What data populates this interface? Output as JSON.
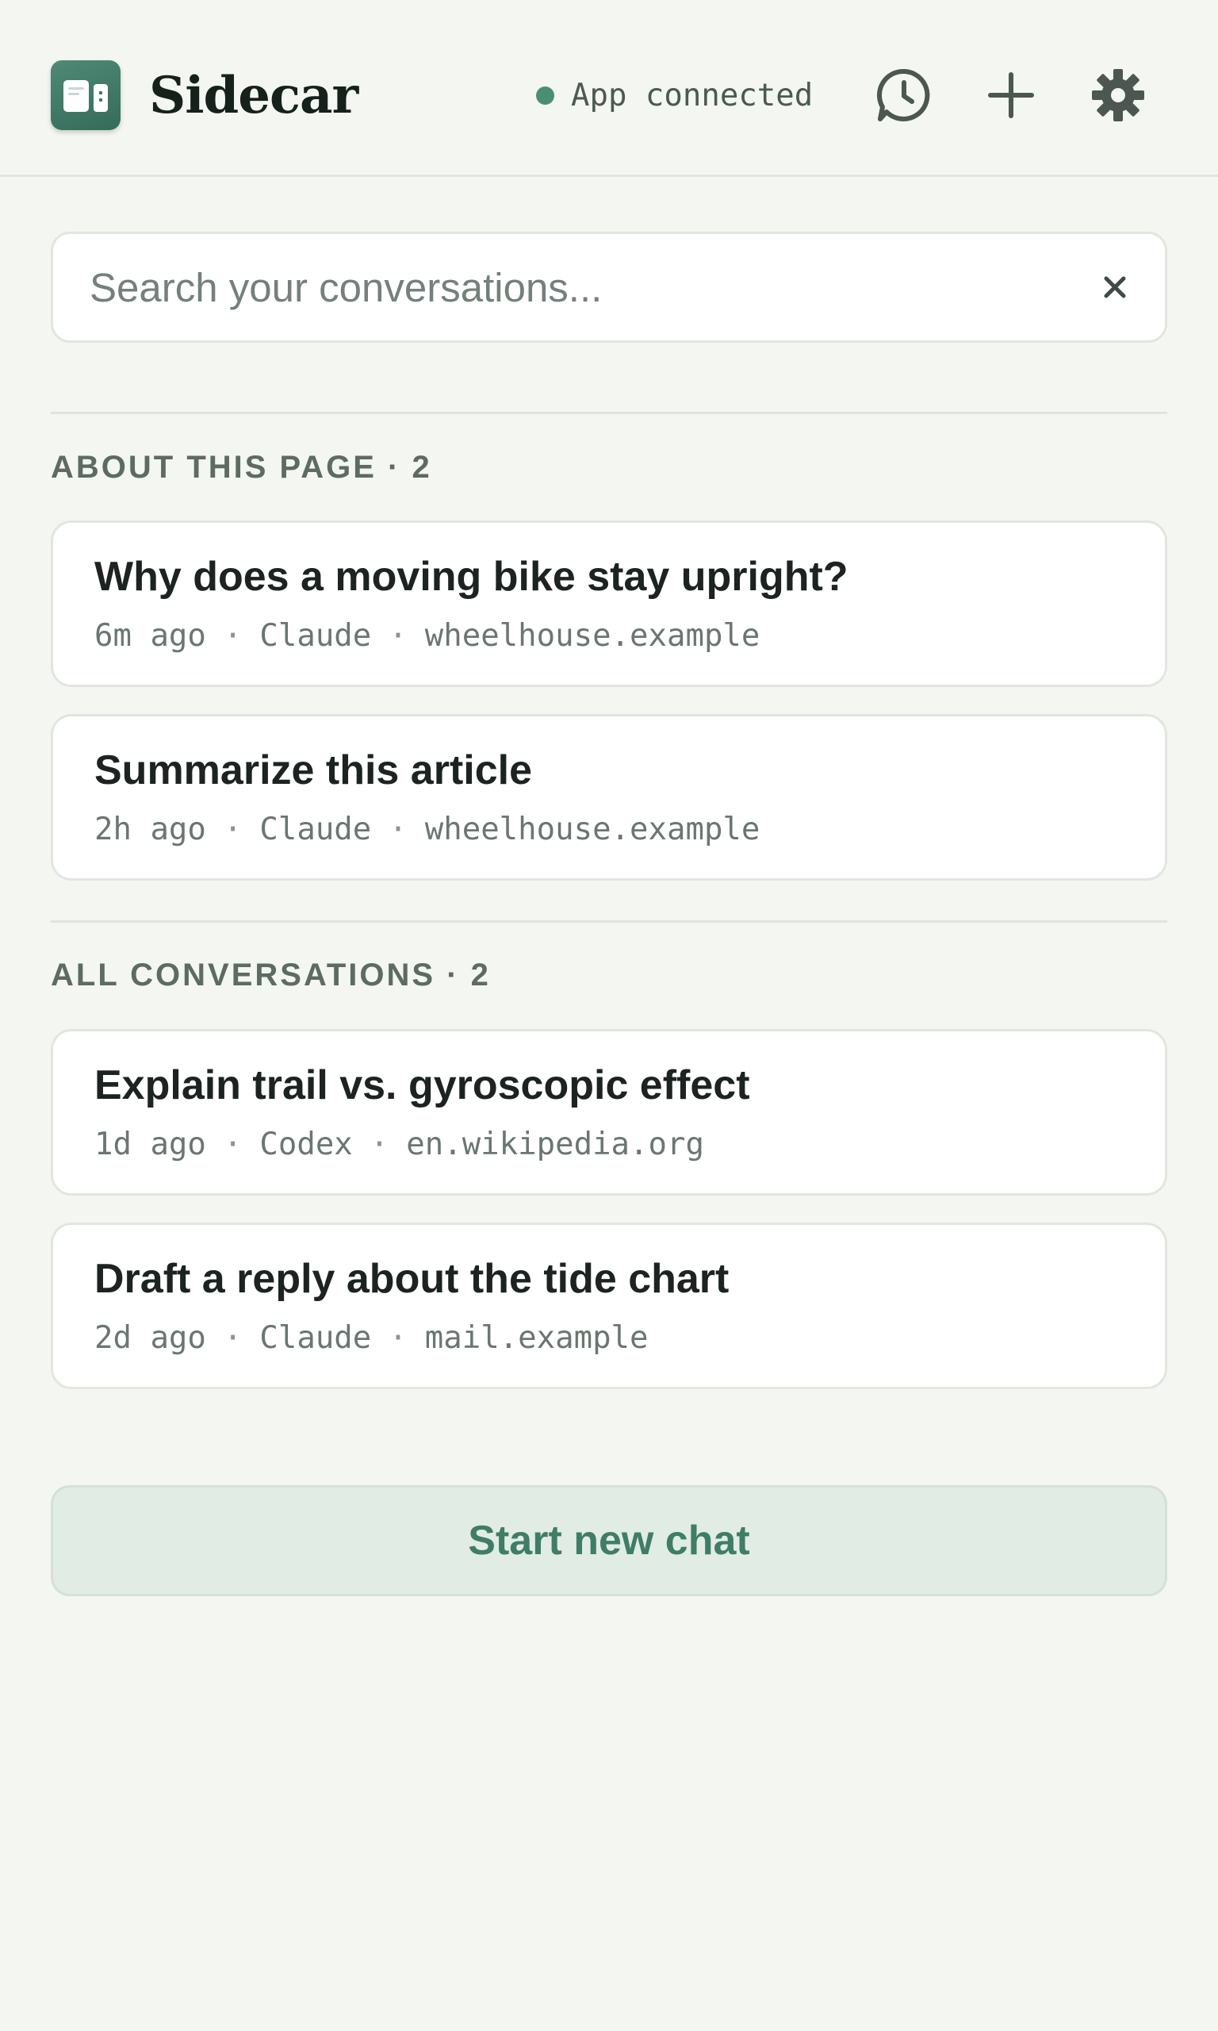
{
  "header": {
    "app_name": "Sidecar",
    "status_text": "App connected",
    "status_color": "#4b8f72",
    "actions": [
      {
        "icon": "history-icon"
      },
      {
        "icon": "plus-icon"
      },
      {
        "icon": "gear-icon"
      }
    ]
  },
  "search": {
    "placeholder": "Search your conversations...",
    "value": "",
    "clear_icon": "close-icon"
  },
  "sections": {
    "about_page": {
      "label": "ABOUT THIS PAGE · 2",
      "items": [
        {
          "title": "Why does a moving bike stay upright?",
          "time": "6m ago",
          "model": "Claude",
          "site": "wheelhouse.example"
        },
        {
          "title": "Summarize this article",
          "time": "2h ago",
          "model": "Claude",
          "site": "wheelhouse.example"
        }
      ]
    },
    "all": {
      "label": "ALL CONVERSATIONS · 2",
      "items": [
        {
          "title": "Explain trail vs. gyroscopic effect",
          "time": "1d ago",
          "model": "Codex",
          "site": "en.wikipedia.org"
        },
        {
          "title": "Draft a reply about the tide chart",
          "time": "2d ago",
          "model": "Claude",
          "site": "mail.example"
        }
      ]
    }
  },
  "footer": {
    "start_label": "Start new chat"
  },
  "colors": {
    "accent": "#3f7d66",
    "background": "#f3f6f1",
    "button_bg": "#e1ece5"
  }
}
